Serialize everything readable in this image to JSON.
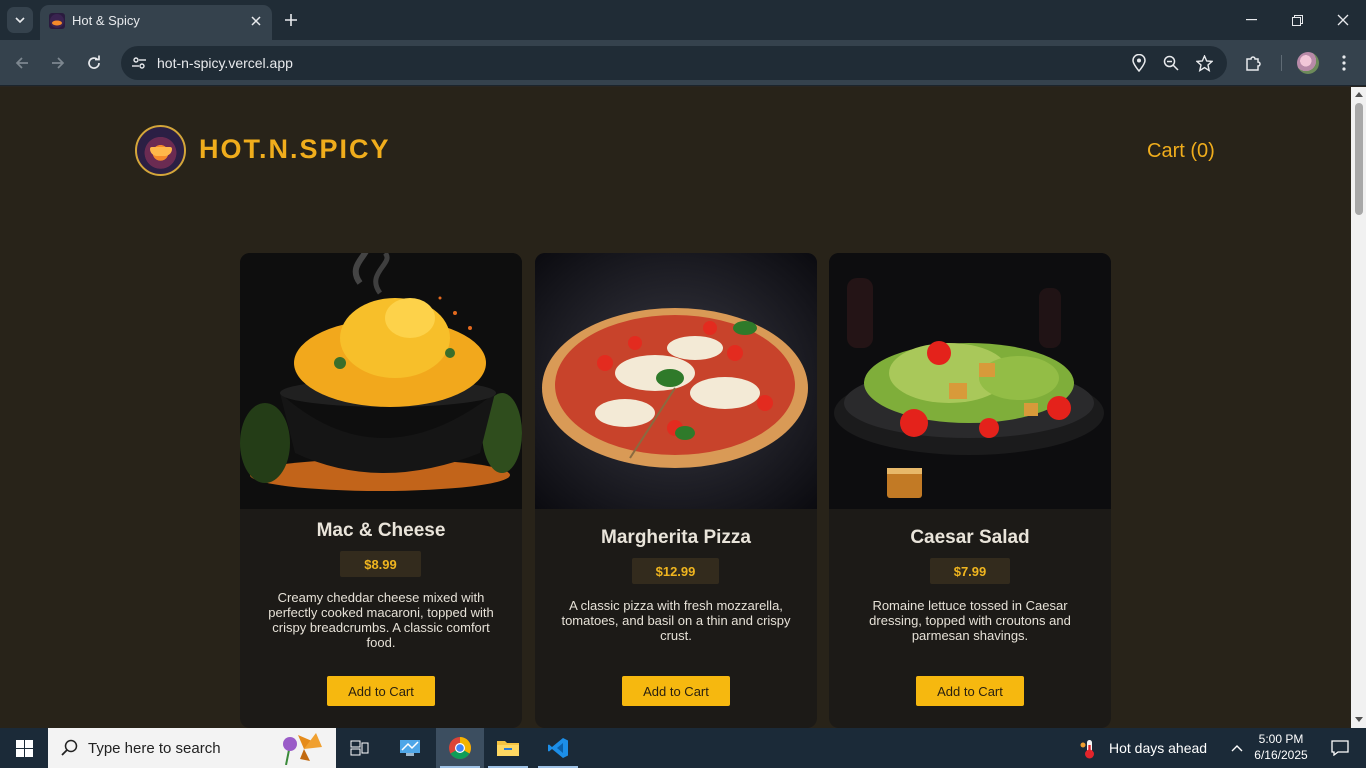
{
  "browser": {
    "tab_title": "Hot & Spicy",
    "url": "hot-n-spicy.vercel.app"
  },
  "site": {
    "brand": "HOT.N.SPICY",
    "cart_label": "Cart (0)"
  },
  "menu": [
    {
      "name": "Mac & Cheese",
      "price": "$8.99",
      "description": "Creamy cheddar cheese mixed with perfectly cooked macaroni, topped with crispy breadcrumbs. A classic comfort food.",
      "button": "Add to Cart"
    },
    {
      "name": "Margherita Pizza",
      "price": "$12.99",
      "description": "A classic pizza with fresh mozzarella, tomatoes, and basil on a thin and crispy crust.",
      "button": "Add to Cart"
    },
    {
      "name": "Caesar Salad",
      "price": "$7.99",
      "description": "Romaine lettuce tossed in Caesar dressing, topped with croutons and parmesan shavings.",
      "button": "Add to Cart"
    }
  ],
  "taskbar": {
    "search_placeholder": "Type here to search",
    "weather": "Hot days ahead",
    "time": "5:00 PM",
    "date": "6/16/2025"
  },
  "colors": {
    "accent": "#f0ad1c",
    "page_bg": "#282319",
    "card_bg": "#1c1a17",
    "button_bg": "#f6b80f"
  }
}
